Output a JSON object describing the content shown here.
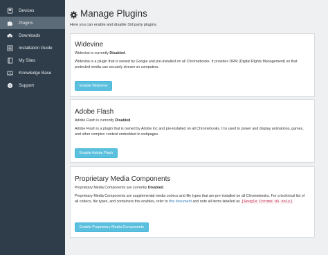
{
  "sidebar": {
    "items": [
      {
        "label": "Devices",
        "icon": "device-icon",
        "active": false
      },
      {
        "label": "Plugins",
        "icon": "puzzle-icon",
        "active": true
      },
      {
        "label": "Downloads",
        "icon": "cloud-download-icon",
        "active": false
      },
      {
        "label": "Installation Guide",
        "icon": "list-icon",
        "active": false
      },
      {
        "label": "My Sites",
        "icon": "book-icon",
        "active": false
      },
      {
        "label": "Knowledge Base",
        "icon": "book-open-icon",
        "active": false
      },
      {
        "label": "Support",
        "icon": "info-icon",
        "active": false
      }
    ]
  },
  "header": {
    "title": "Manage Plugins",
    "subtitle": "Here you can enable and disable 3rd party plugins."
  },
  "plugins": {
    "widevine": {
      "title": "Widevine",
      "status_prefix": "Widevine is currently ",
      "status": "Disabled",
      "status_suffix": ".",
      "description": "Widevine is a plugin that is owned by Google and pre-installed on all Chromebooks. It provides DRM (Digital Rights Management) so that protected media can securely stream on computers.",
      "button": "Enable Widevine"
    },
    "flash": {
      "title": "Adobe Flash",
      "status_prefix": "Adobe Flash is currently ",
      "status": "Disabled",
      "status_suffix": ".",
      "description": "Adobe Flash is a plugin that is owned by Adobe Inc and pre-installed on all Chromebooks. It is used to power and display animations, games, and other complex content embedded in webpages.",
      "button": "Enable Adobe Flash"
    },
    "proprietary": {
      "title": "Proprietary Media Components",
      "status_prefix": "Proprietary Media Components are currently ",
      "status": "Disabled",
      "status_suffix": ".",
      "description_1": "Proprietary Media Components are supplemental media codecs and file types that are pre-installed on all Chromebooks. For a technical list of all codecs, file types, and containers this enables, refer to ",
      "link": "this document",
      "description_2": " and note all items labelled as ",
      "code": "[Google Chrome OS only]",
      "description_3": ".",
      "button": "Enable Proprietary Media Components"
    }
  },
  "colors": {
    "sidebar_bg": "#2f3d4a",
    "sidebar_active": "#5c6b78",
    "button_bg": "#5bc0de",
    "link": "#337ab7"
  }
}
